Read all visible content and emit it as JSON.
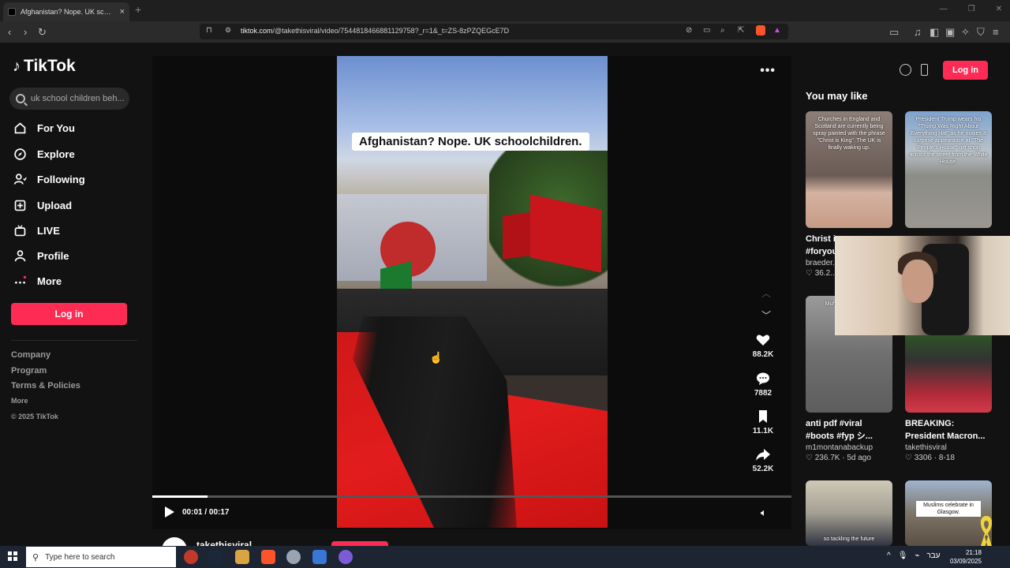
{
  "browser": {
    "tab_title": "Afghanistan? Nope. UK schoolchi",
    "tab_close": "×",
    "new_tab": "+",
    "url_domain": "tiktok.com",
    "url_path": "/@takethisviral/video/7544818466881129758?_r=1&_t=ZS-8zPZQEGcE7D",
    "window_controls": [
      "—",
      "❐",
      "✕"
    ]
  },
  "sidebar": {
    "logo": "TikTok",
    "search_placeholder": "uk school children beh...",
    "nav": [
      {
        "label": "For You",
        "icon": "home-icon"
      },
      {
        "label": "Explore",
        "icon": "compass-icon"
      },
      {
        "label": "Following",
        "icon": "following-icon"
      },
      {
        "label": "Upload",
        "icon": "upload-icon"
      },
      {
        "label": "LIVE",
        "icon": "live-icon"
      },
      {
        "label": "Profile",
        "icon": "profile-icon"
      },
      {
        "label": "More",
        "icon": "more-icon"
      }
    ],
    "login": "Log in",
    "footer": {
      "company": "Company",
      "program": "Program",
      "terms": "Terms & Policies",
      "more": "More",
      "copyright": "© 2025 TikTok"
    }
  },
  "video": {
    "caption": "Afghanistan? Nope. UK schoolchildren.",
    "likes": "88.2K",
    "comments": "7882",
    "saves": "11.1K",
    "shares": "52.2K",
    "time": "00:01 / 00:17",
    "progress": 0.086,
    "author": "takethisviral"
  },
  "right": {
    "login": "Log in",
    "heading": "You may like",
    "cards": [
      {
        "thumb_text": "Churches in England and Scotland are currently being spray painted with the phrase \"Christ is King\". The UK is finally waking up.",
        "title": "Christ i...",
        "title2": "#foryou...",
        "author": "braeder...",
        "stats": "♡ 36.2..."
      },
      {
        "thumb_text": "President Trump wears his \"Trump Was Right About Everything Hat\" as he makes a surprise appearance at \"The People's House\" gift shop across the street from the White House.",
        "title": "",
        "author": "",
        "stats": ""
      },
      {
        "thumb_text": "Muh... va... Jesse...",
        "title": "anti pdf #viral",
        "title2": "#boots #fyp シ...",
        "author": "m1montanabackup",
        "stats": "♡ 236.7K · 5d ago"
      },
      {
        "thumb_text": "",
        "title": "BREAKING:",
        "title2": "President Macron...",
        "author": "takethisviral",
        "stats": "♡ 3306 · 8-18"
      },
      {
        "thumb_text": "so tackling the future",
        "title": "",
        "author": "",
        "stats": ""
      },
      {
        "thumb_text": "Muslims celebrate in Glasgow.",
        "title": "",
        "author": "",
        "stats": ""
      }
    ]
  },
  "taskbar": {
    "search_placeholder": "Type here to search",
    "time": "21:18",
    "date": "03/09/2025",
    "lang": "עבר"
  },
  "colors": {
    "accent": "#fe2c55",
    "background": "#121212"
  }
}
